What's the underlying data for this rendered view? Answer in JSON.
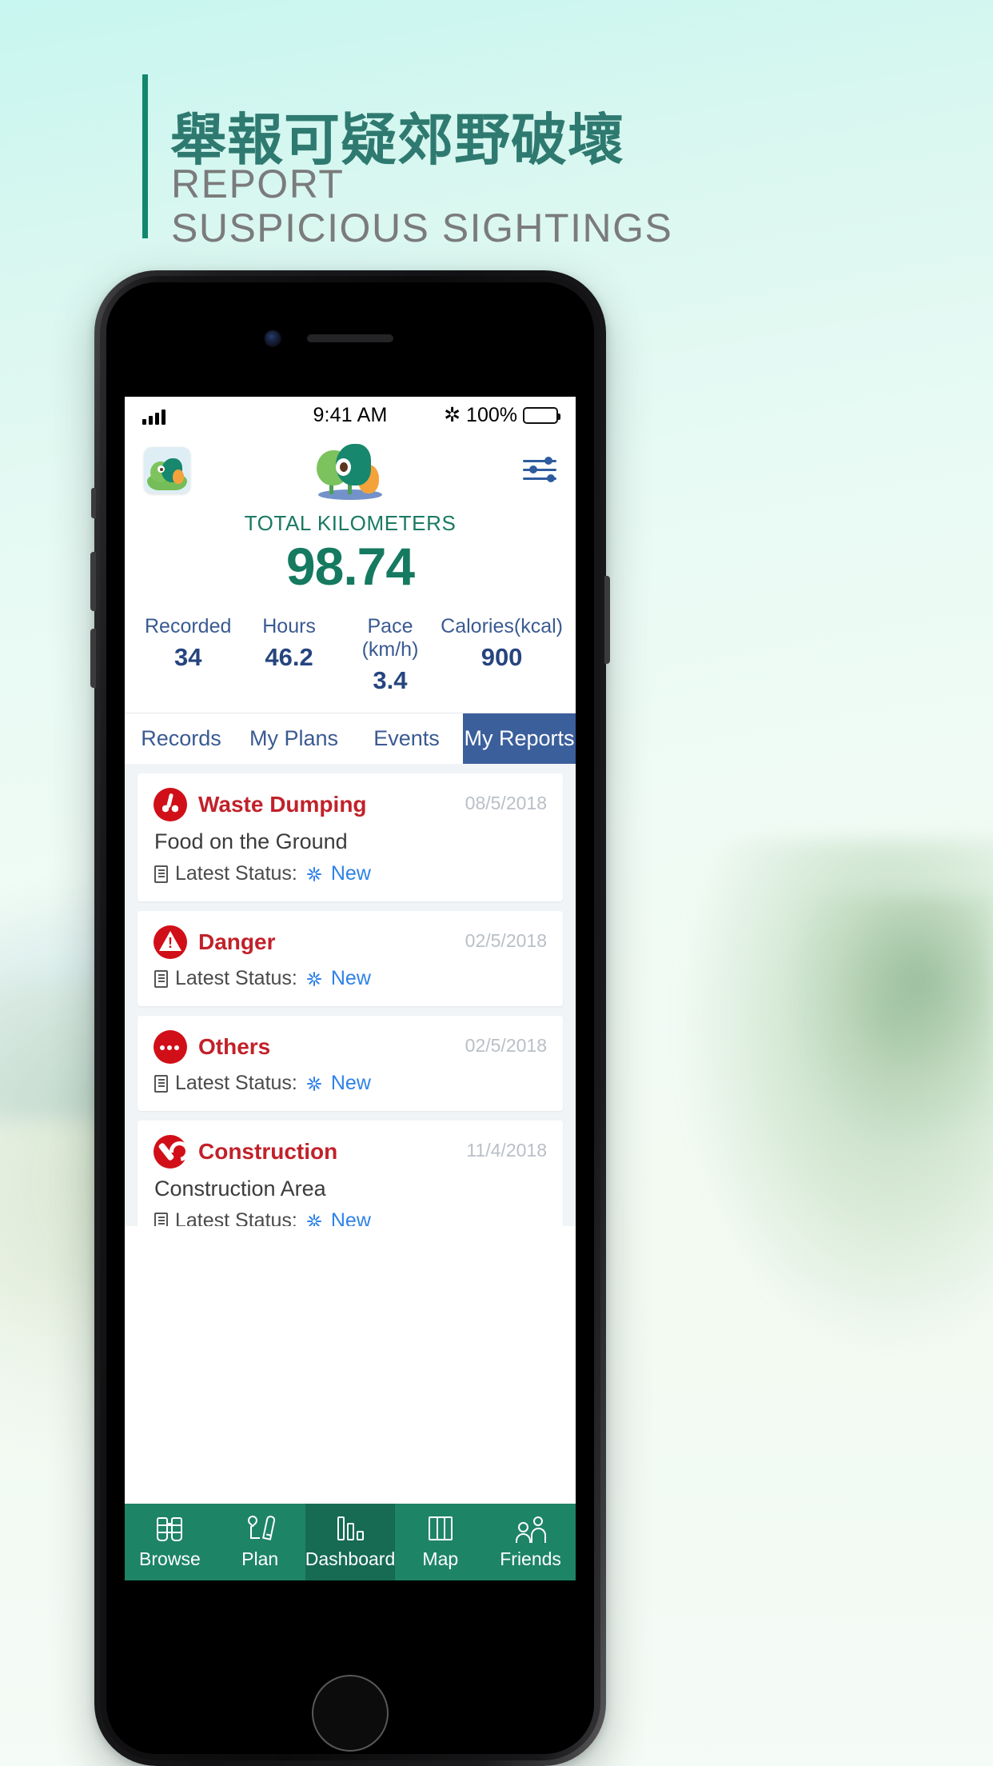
{
  "poster": {
    "headline_cn": "舉報可疑郊野破壞",
    "headline_en_line1": "REPORT",
    "headline_en_line2": "SUSPICIOUS SIGHTINGS",
    "accent_green": "#12866d",
    "headline_cn_color": "#2f7a70",
    "headline_en_color": "#7b7b7b"
  },
  "status_bar": {
    "time": "9:41 AM",
    "battery_percent": "100%",
    "bluetooth_glyph": "✲",
    "signal_icon": "signal-bars-icon",
    "battery_icon": "battery-full-icon"
  },
  "app_header": {
    "avatar_icon": "user-avatar",
    "logo_icon": "tree-mascot-logo",
    "filter_icon": "filter-sliders-icon",
    "kilometers_label": "TOTAL KILOMETERS",
    "kilometers_value": "98.74",
    "label_color": "#1a7a63",
    "value_color": "#157a5f"
  },
  "stats": [
    {
      "label": "Recorded",
      "value": "34"
    },
    {
      "label": "Hours",
      "value": "46.2"
    },
    {
      "label": "Pace (km/h)",
      "value": "3.4"
    },
    {
      "label": "Calories(kcal)",
      "value": "900"
    }
  ],
  "tabs": {
    "items": [
      {
        "label": "Records",
        "active": false
      },
      {
        "label": "My Plans",
        "active": false
      },
      {
        "label": "Events",
        "active": false
      },
      {
        "label": "My Reports",
        "active": true
      }
    ],
    "active_bg": "#3b5f9b",
    "inactive_color": "#3a5a92"
  },
  "reports": {
    "status_prefix": "Latest Status:",
    "status_icon": "document-icon",
    "new_icon": "sparkle-icon",
    "title_color": "#c2212a",
    "badge_color": "#d10f18",
    "status_new_color": "#2f82e8",
    "items": [
      {
        "type": "Waste Dumping",
        "icon": "waste-dumping-icon",
        "description": "Food on the Ground",
        "date": "08/5/2018",
        "status": "New"
      },
      {
        "type": "Danger",
        "icon": "danger-warning-icon",
        "description": "",
        "date": "02/5/2018",
        "status": "New"
      },
      {
        "type": "Others",
        "icon": "others-ellipsis-icon",
        "description": "",
        "date": "02/5/2018",
        "status": "New"
      },
      {
        "type": "Construction",
        "icon": "construction-wrench-icon",
        "description": "Construction Area",
        "date": "11/4/2018",
        "status": "New"
      }
    ]
  },
  "bottom_nav": {
    "bg": "#1e8466",
    "active_bg": "#166b52",
    "items": [
      {
        "label": "Browse",
        "icon": "binoculars-icon",
        "active": false
      },
      {
        "label": "Plan",
        "icon": "pin-pencil-icon",
        "active": false
      },
      {
        "label": "Dashboard",
        "icon": "bar-chart-icon",
        "active": true
      },
      {
        "label": "Map",
        "icon": "map-fold-icon",
        "active": false
      },
      {
        "label": "Friends",
        "icon": "people-icon",
        "active": false
      }
    ]
  }
}
